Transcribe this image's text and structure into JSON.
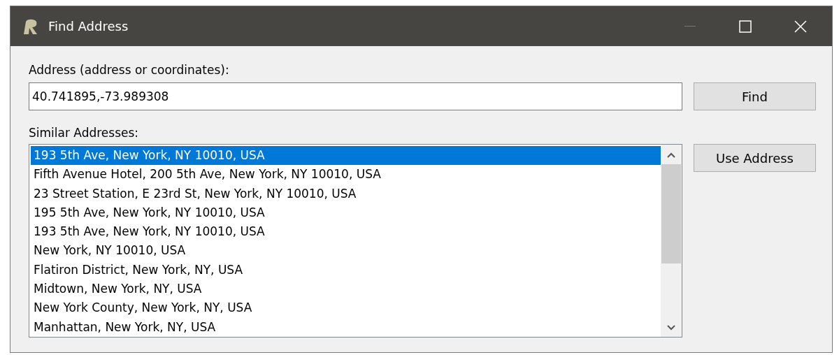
{
  "window": {
    "title": "Find Address"
  },
  "address": {
    "label": "Address (address or coordinates):",
    "value": "40.741895,-73.989308"
  },
  "buttons": [
    "Find",
    "Use Address"
  ],
  "similar": {
    "label": "Similar Addresses:",
    "items": [
      {
        "text": "193 5th Ave, New York, NY 10010, USA",
        "selected": true
      },
      {
        "text": "Fifth Avenue Hotel, 200 5th Ave, New York, NY 10010, USA",
        "selected": false
      },
      {
        "text": "23 Street Station, E 23rd St, New York, NY 10010, USA",
        "selected": false
      },
      {
        "text": "195 5th Ave, New York, NY 10010, USA",
        "selected": false
      },
      {
        "text": "193 5th Ave, New York, NY 10010, USA",
        "selected": false
      },
      {
        "text": "New York, NY 10010, USA",
        "selected": false
      },
      {
        "text": "Flatiron District, New York, NY, USA",
        "selected": false
      },
      {
        "text": "Midtown, New York, NY, USA",
        "selected": false
      },
      {
        "text": "New York County, New York, NY, USA",
        "selected": false
      },
      {
        "text": "Manhattan, New York, NY, USA",
        "selected": false
      }
    ]
  }
}
